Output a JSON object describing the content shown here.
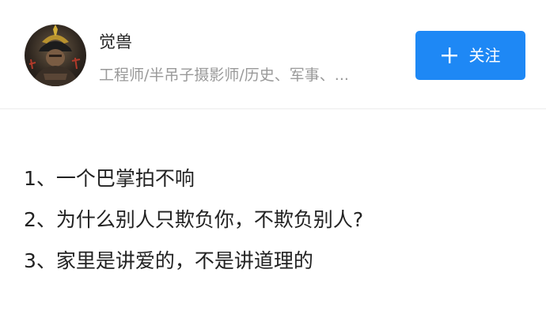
{
  "author": {
    "name": "觉兽",
    "description": "工程师/半吊子摄影师/历史、军事、...",
    "avatar_alt": "avatar"
  },
  "follow_button": {
    "icon": "plus-icon",
    "label": "关注",
    "color": "#1e88f5"
  },
  "content": {
    "lines": [
      "1、一个巴掌拍不响",
      "2、为什么别人只欺负你，不欺负别人?",
      "3、家里是讲爱的，不是讲道理的"
    ]
  }
}
